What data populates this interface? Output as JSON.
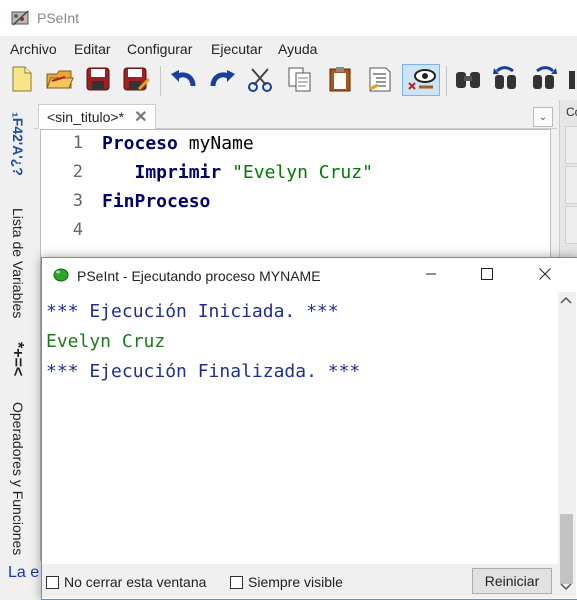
{
  "app": {
    "title": "PSeInt",
    "icon": "pseint-app-icon"
  },
  "menu": {
    "items": [
      "Archivo",
      "Editar",
      "Configurar",
      "Ejecutar",
      "Ayuda"
    ]
  },
  "toolbar": {
    "buttons": [
      {
        "icon": "new-file-icon"
      },
      {
        "icon": "open-folder-icon"
      },
      {
        "icon": "save-icon"
      },
      {
        "icon": "save-as-icon"
      },
      {
        "icon": "undo-icon"
      },
      {
        "icon": "redo-icon"
      },
      {
        "icon": "cut-icon"
      },
      {
        "icon": "copy-icon"
      },
      {
        "icon": "paste-icon"
      },
      {
        "icon": "indent-icon"
      },
      {
        "icon": "inspect-eye-icon"
      },
      {
        "icon": "find-icon"
      },
      {
        "icon": "find-previous-icon"
      },
      {
        "icon": "find-next-icon"
      }
    ]
  },
  "sidebar": {
    "symbols_label": "₁F42'A'¿?",
    "variables_label": "Lista de Variables",
    "operators_symbols": "*+=<",
    "operators_label": "Operadores y Funciones"
  },
  "tab": {
    "label": "<sin_titulo>*",
    "close": "✕",
    "dropdown": "⌄"
  },
  "right_panel": {
    "label": "Co"
  },
  "editor": {
    "lines": [
      {
        "num": "1",
        "parts": [
          {
            "t": "Proceso",
            "c": "kw"
          },
          {
            "t": " myName",
            "c": "id"
          }
        ]
      },
      {
        "num": "2",
        "parts": [
          {
            "t": "   Imprimir",
            "c": "kw"
          },
          {
            "t": " ",
            "c": "id"
          },
          {
            "t": "\"Evelyn Cruz\"",
            "c": "str"
          }
        ]
      },
      {
        "num": "3",
        "parts": [
          {
            "t": "FinProceso",
            "c": "kw"
          }
        ]
      },
      {
        "num": "4",
        "parts": []
      }
    ]
  },
  "status_bottom": "La e",
  "run_dialog": {
    "title": "PSeInt - Ejecutando proceso MYNAME",
    "controls": {
      "minimize": "—",
      "maximize": "☐",
      "close": "✕"
    },
    "console_lines": [
      {
        "text": "*** Ejecución Iniciada. ***",
        "type": "sys"
      },
      {
        "text": "Evelyn Cruz",
        "type": "out"
      },
      {
        "text": "*** Ejecución Finalizada. ***",
        "type": "sys"
      }
    ],
    "no_close_label": "No cerrar esta ventana",
    "always_visible_label": "Siempre visible",
    "restart_button": "Reiniciar"
  },
  "colors": {
    "keyword": "#00006b",
    "string": "#007a00",
    "console_system": "#1f2f8f",
    "console_output": "#1d7a1d"
  }
}
